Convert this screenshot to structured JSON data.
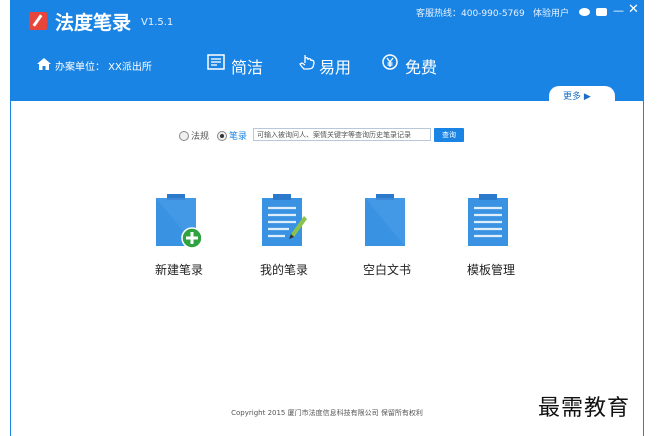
{
  "app": {
    "title": "法度笔录",
    "version": "V1.5.1"
  },
  "topbar": {
    "hotline": "客服热线：400-990-5769",
    "trial_user": "体验用户",
    "minimize": "—",
    "close": "✕"
  },
  "unit": {
    "label": "办案单位：  XX派出所"
  },
  "slogans": [
    "简洁",
    "易用",
    "免费"
  ],
  "more": {
    "label": "更多 ▶"
  },
  "search": {
    "option_law": "法规",
    "option_note": "笔录",
    "placeholder": "可输入被询问人、案情关键字等查询历史笔录记录",
    "button": "查询"
  },
  "tiles": [
    {
      "label": "新建笔录"
    },
    {
      "label": "我的笔录"
    },
    {
      "label": "空白文书"
    },
    {
      "label": "模板管理"
    }
  ],
  "footer": {
    "copyright": "Copyright 2015 厦门市法度信息科技有限公司 保留所有权利"
  },
  "watermark": {
    "text": "最需教育"
  },
  "colors": {
    "brand": "#1a84e4",
    "accent_green": "#2fa33f",
    "tile_blue": "#3a92e3"
  }
}
